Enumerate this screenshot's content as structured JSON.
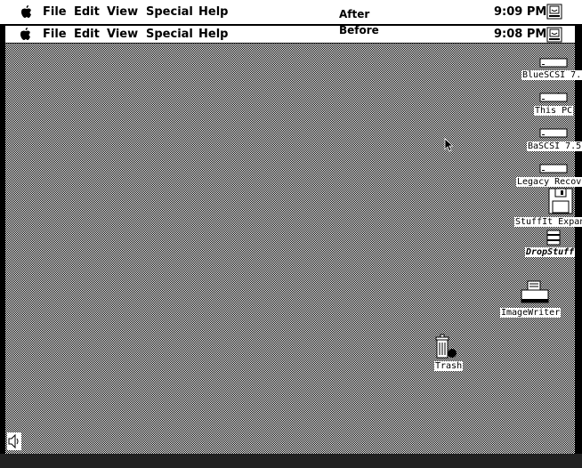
{
  "menubar_after": {
    "apple": "apple-icon",
    "menus": [
      "File",
      "Edit",
      "View",
      "Special",
      "Help"
    ],
    "banner": "After",
    "clock": "9:09 PM",
    "app_icon": "finder-icon"
  },
  "menubar_before": {
    "apple": "apple-icon",
    "menus": [
      "File",
      "Edit",
      "View",
      "Special",
      "Help"
    ],
    "banner": "Before",
    "clock": "9:08 PM",
    "app_icon": "finder-icon"
  },
  "desktop_icons": [
    {
      "label": "BlueSCSI 7.",
      "icon": "hard-disk-icon"
    },
    {
      "label": "This PC",
      "icon": "hard-disk-icon"
    },
    {
      "label": "BaSCSI 7.5",
      "icon": "hard-disk-icon"
    },
    {
      "label": "Legacy Recov",
      "icon": "hard-disk-icon"
    },
    {
      "label": "StuffIt Expan",
      "icon": "floppy-icon"
    },
    {
      "label": "DropStuff",
      "icon": "dropstuff-icon"
    },
    {
      "label": "ImageWriter",
      "icon": "printer-icon"
    },
    {
      "label": "Trash",
      "icon": "trash-icon"
    }
  ]
}
